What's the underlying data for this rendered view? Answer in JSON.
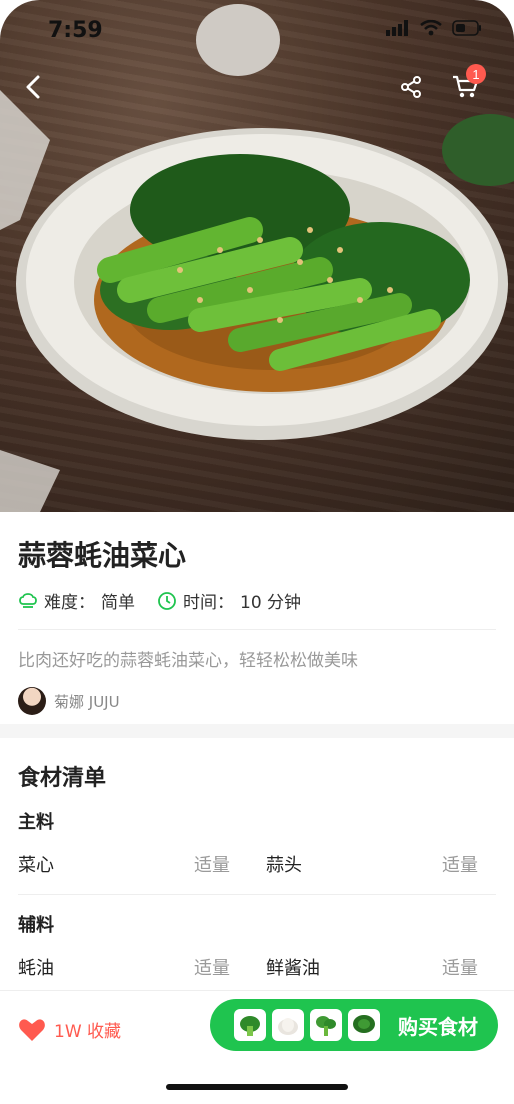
{
  "status_bar": {
    "time": "7:59"
  },
  "header": {
    "cart_badge": "1"
  },
  "recipe": {
    "title": "蒜蓉蚝油菜心",
    "difficulty_label": "难度：",
    "difficulty_value": "简单",
    "time_label": "时间：",
    "time_value": "10 分钟",
    "description": "比肉还好吃的蒜蓉蚝油菜心，轻轻松松做美味",
    "author": "菊娜 JUJU"
  },
  "ingredients": {
    "title": "食材清单",
    "main_label": "主料",
    "main": [
      {
        "name": "菜心",
        "amount": "适量"
      },
      {
        "name": "蒜头",
        "amount": "适量"
      }
    ],
    "aux_label": "辅料",
    "aux": [
      {
        "name": "蚝油",
        "amount": "适量"
      },
      {
        "name": "鲜酱油",
        "amount": "适量"
      }
    ]
  },
  "bottom_bar": {
    "favorite_label": "1W 收藏",
    "buy_label": "购买食材"
  },
  "colors": {
    "accent_green": "#1fc44f",
    "accent_red": "#ff5a4f"
  },
  "icons": [
    "back-icon",
    "share-icon",
    "cart-icon",
    "chef-hat-icon",
    "clock-icon",
    "heart-icon"
  ]
}
